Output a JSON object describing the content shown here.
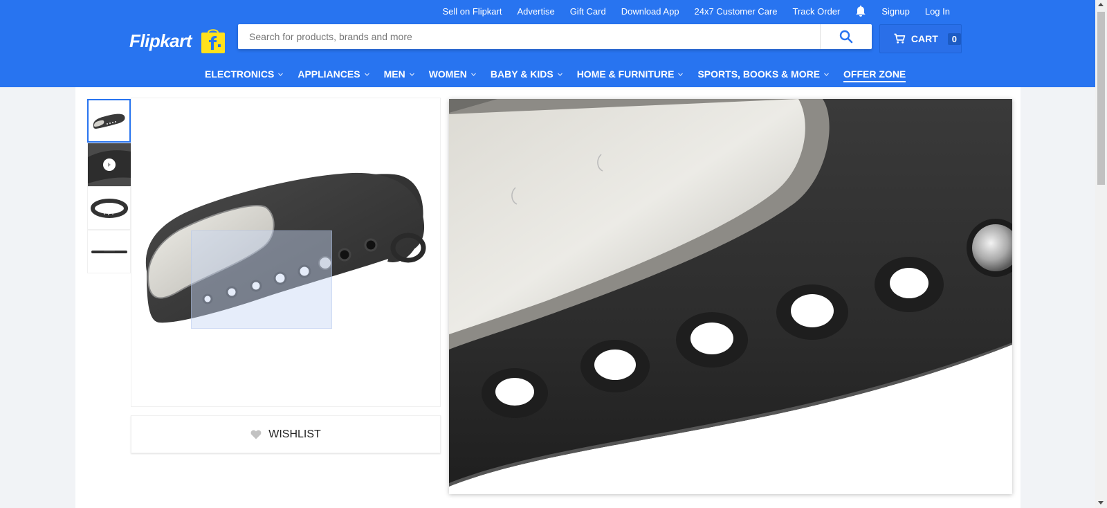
{
  "header": {
    "logo_text": "Flipkart",
    "top_links": [
      {
        "label": "Sell on Flipkart"
      },
      {
        "label": "Advertise"
      },
      {
        "label": "Gift Card"
      },
      {
        "label": "Download App"
      },
      {
        "label": "24x7 Customer Care"
      },
      {
        "label": "Track Order"
      }
    ],
    "signup": "Signup",
    "login": "Log In",
    "search": {
      "placeholder": "Search for products, brands and more"
    },
    "cart": {
      "label": "CART",
      "count": "0"
    },
    "nav": [
      {
        "label": "ELECTRONICS"
      },
      {
        "label": "APPLIANCES"
      },
      {
        "label": "MEN"
      },
      {
        "label": "WOMEN"
      },
      {
        "label": "BABY & KIDS"
      },
      {
        "label": "HOME & FURNITURE"
      },
      {
        "label": "SPORTS, BOOKS & MORE"
      },
      {
        "label": "OFFER ZONE"
      }
    ]
  },
  "product": {
    "wishlist_label": "WISHLIST",
    "thumbnails": [
      "band-front",
      "band-video",
      "band-round",
      "band-side"
    ]
  },
  "icons": {
    "search": "search-icon",
    "cart": "cart-icon",
    "bell": "bell-icon",
    "heart": "heart-icon",
    "chevron": "chevron-down-icon",
    "play": "play-icon"
  },
  "colors": {
    "brand_blue": "#2874f0",
    "logo_yellow": "#ffe11b",
    "page_bg": "#f1f3f6"
  }
}
